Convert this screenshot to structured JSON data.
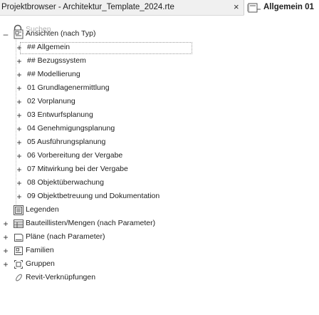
{
  "window": {
    "title": "Projektbrowser - Architektur_Template_2024.rte",
    "close_glyph": "×",
    "view_tab_label": "Allgemein 01"
  },
  "search": {
    "placeholder": "Suchen",
    "value": ""
  },
  "tree": {
    "views_root": {
      "label": "Ansichten (nach Typ)",
      "expander": "–",
      "icon": "views-icon"
    },
    "view_groups": [
      "## Allgemein",
      "## Bezugssystem",
      "## Modellierung",
      "01 Grundlagenermittlung",
      "02 Vorplanung",
      "03 Entwurfsplanung",
      "04 Genehmigungsplanung",
      "05 Ausführungsplanung",
      "06 Vorbereitung der Vergabe",
      "07 Mitwirkung bei der Vergabe",
      "08 Objektüberwachung",
      "09 Objektbetreuung und Dokumentation"
    ],
    "expand_glyph": "+",
    "legends": {
      "label": "Legenden",
      "icon": "legend-icon"
    },
    "schedules": {
      "label": "Bauteillisten/Mengen (nach Parameter)",
      "icon": "schedule-icon"
    },
    "sheets": {
      "label": "Pläne (nach Parameter)",
      "icon": "sheet-icon"
    },
    "families": {
      "label": "Familien",
      "icon": "family-icon"
    },
    "groups": {
      "label": "Gruppen",
      "icon": "group-icon"
    },
    "revit_links": {
      "label": "Revit-Verknüpfungen",
      "icon": "link-icon"
    }
  }
}
